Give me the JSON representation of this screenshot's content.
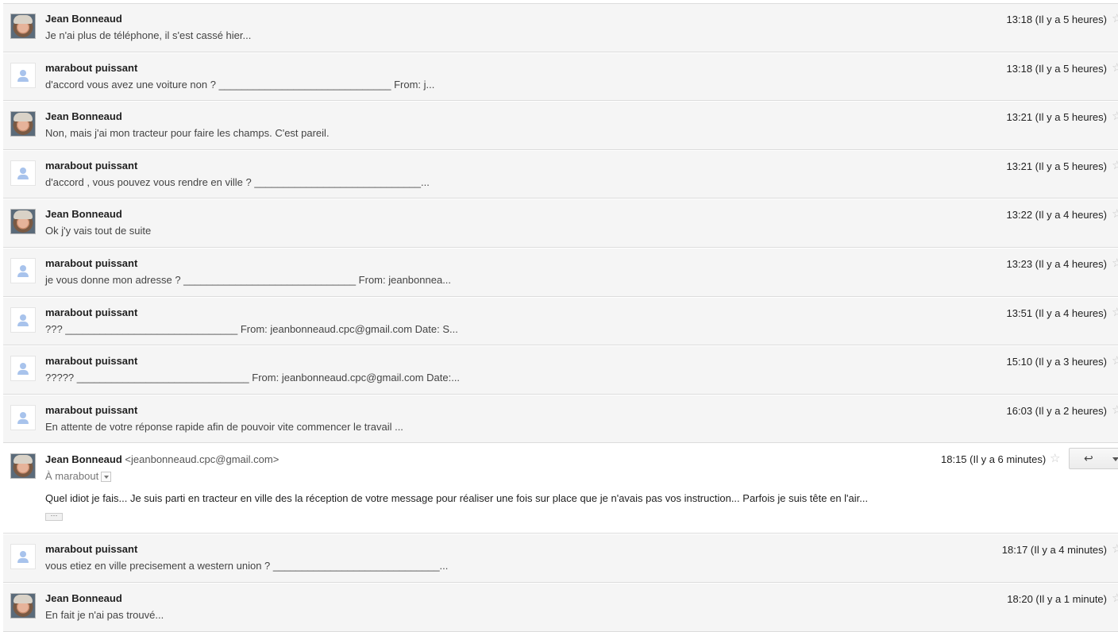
{
  "messages": [
    {
      "sender": "Jean Bonneaud",
      "avatar": "photo",
      "snippet": "Je n'ai plus de téléphone, il s'est cassé hier...",
      "date": "13:18 (Il y a 5 heures)"
    },
    {
      "sender": "marabout puissant",
      "avatar": "generic",
      "snippet": "d'accord vous avez une voiture non ? ______________________________ From: j...",
      "date": "13:18 (Il y a 5 heures)"
    },
    {
      "sender": "Jean Bonneaud",
      "avatar": "photo",
      "snippet": "Non, mais j'ai mon tracteur pour faire les champs. C'est pareil.",
      "date": "13:21 (Il y a 5 heures)"
    },
    {
      "sender": "marabout puissant",
      "avatar": "generic",
      "snippet": "d'accord , vous pouvez vous rendre en ville ? _____________________________...",
      "date": "13:21 (Il y a 5 heures)"
    },
    {
      "sender": "Jean Bonneaud",
      "avatar": "photo",
      "snippet": "Ok j'y vais tout de suite",
      "date": "13:22 (Il y a 4 heures)"
    },
    {
      "sender": "marabout puissant",
      "avatar": "generic",
      "snippet": "je vous donne mon adresse ? ______________________________ From: jeanbonnea...",
      "date": "13:23 (Il y a 4 heures)"
    },
    {
      "sender": "marabout puissant",
      "avatar": "generic",
      "snippet": "??? ______________________________ From: jeanbonneaud.cpc@gmail.com Date: S...",
      "date": "13:51 (Il y a 4 heures)"
    },
    {
      "sender": "marabout puissant",
      "avatar": "generic",
      "snippet": "????? ______________________________ From: jeanbonneaud.cpc@gmail.com Date:...",
      "date": "15:10 (Il y a 3 heures)"
    },
    {
      "sender": "marabout puissant",
      "avatar": "generic",
      "snippet": "En attente de votre réponse rapide afin de pouvoir vite commencer le travail ...",
      "date": "16:03 (Il y a 2 heures)"
    }
  ],
  "expanded": {
    "sender": "Jean Bonneaud",
    "email": "<jeanbonneaud.cpc@gmail.com>",
    "to": "À marabout",
    "date": "18:15 (Il y a 6 minutes)",
    "body": "Quel idiot je fais... Je suis parti en tracteur en ville des la réception de votre message pour réaliser une fois sur place que je n'avais pas vos instruction... Parfois je suis tête en l'air...",
    "show_trimmed": "···"
  },
  "after": [
    {
      "sender": "marabout puissant",
      "avatar": "generic",
      "snippet": "vous etiez en ville precisement a western union ? _____________________________...",
      "date": "18:17 (Il y a 4 minutes)"
    },
    {
      "sender": "Jean Bonneaud",
      "avatar": "photo",
      "snippet": "En fait je n'ai pas trouvé...",
      "date": "18:20 (Il y a 1 minute)"
    }
  ],
  "icons": {
    "star": "star-icon",
    "reply": "reply-icon",
    "more": "chevron-down-icon",
    "avatar_generic": "person-icon"
  }
}
